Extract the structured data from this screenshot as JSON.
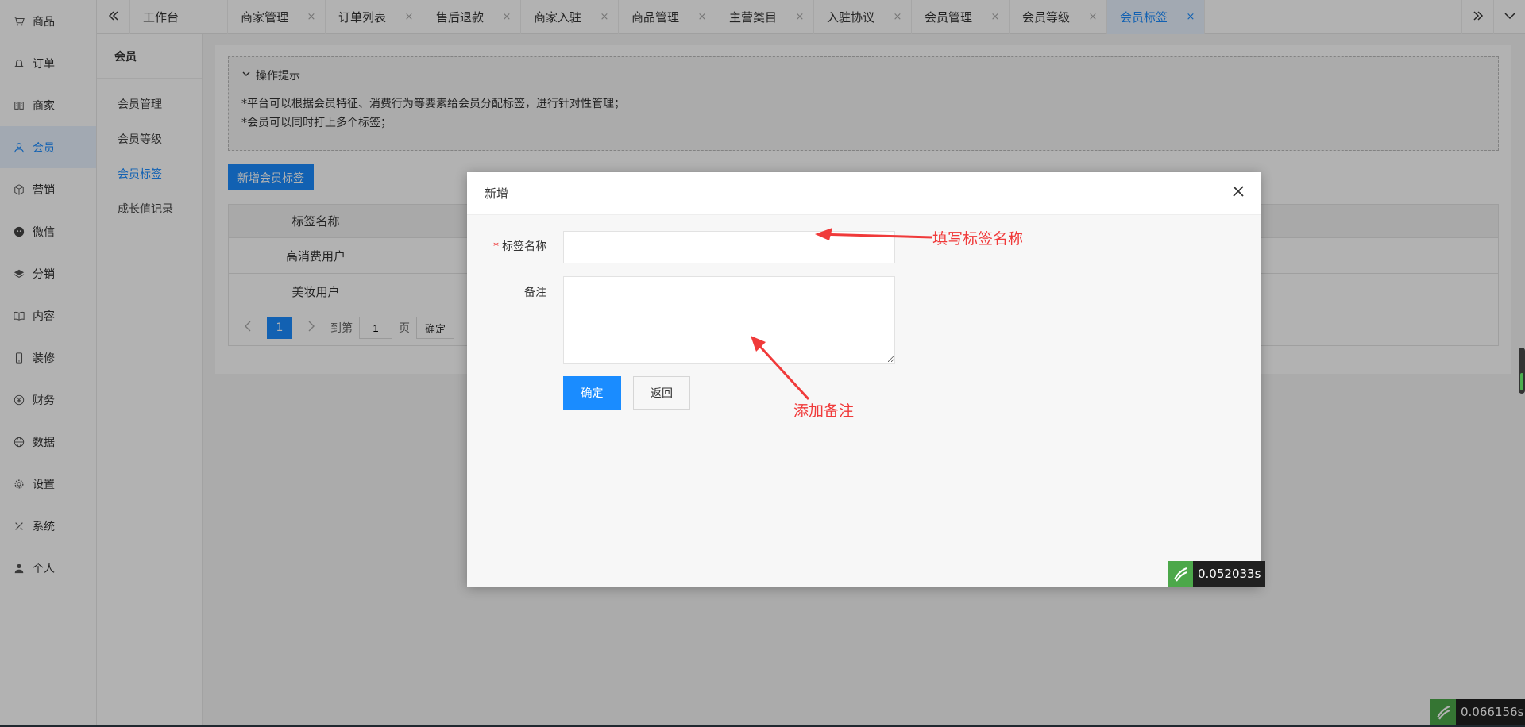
{
  "mainnav": {
    "items": [
      {
        "label": "商品",
        "icon": "cart-icon"
      },
      {
        "label": "订单",
        "icon": "bell-icon"
      },
      {
        "label": "商家",
        "icon": "store-icon"
      },
      {
        "label": "会员",
        "icon": "user-icon",
        "active": true
      },
      {
        "label": "营销",
        "icon": "box-icon"
      },
      {
        "label": "微信",
        "icon": "wechat-icon"
      },
      {
        "label": "分销",
        "icon": "layers-icon"
      },
      {
        "label": "内容",
        "icon": "book-icon"
      },
      {
        "label": "装修",
        "icon": "mobile-icon"
      },
      {
        "label": "财务",
        "icon": "yen-icon"
      },
      {
        "label": "数据",
        "icon": "globe-icon"
      },
      {
        "label": "设置",
        "icon": "gear-icon"
      },
      {
        "label": "系统",
        "icon": "tools-icon"
      },
      {
        "label": "个人",
        "icon": "person-icon"
      }
    ]
  },
  "subnav": {
    "title": "会员",
    "items": [
      {
        "label": "会员管理"
      },
      {
        "label": "会员等级"
      },
      {
        "label": "会员标签",
        "active": true
      },
      {
        "label": "成长值记录"
      }
    ]
  },
  "tabbar": {
    "tabs": [
      {
        "label": "工作台",
        "closable": false
      },
      {
        "label": "商家管理",
        "closable": true
      },
      {
        "label": "订单列表",
        "closable": true
      },
      {
        "label": "售后退款",
        "closable": true
      },
      {
        "label": "商家入驻",
        "closable": true
      },
      {
        "label": "商品管理",
        "closable": true
      },
      {
        "label": "主营类目",
        "closable": true
      },
      {
        "label": "入驻协议",
        "closable": true
      },
      {
        "label": "会员管理",
        "closable": true
      },
      {
        "label": "会员等级",
        "closable": true
      },
      {
        "label": "会员标签",
        "closable": true,
        "active": true
      }
    ],
    "close_glyph": "×"
  },
  "tips": {
    "title": "操作提示",
    "lines": [
      "*平台可以根据会员特征、消费行为等要素给会员分配标签，进行针对性管理；",
      "*会员可以同时打上多个标签；"
    ]
  },
  "add_button": "新增会员标签",
  "table": {
    "header": "标签名称",
    "rows": [
      "高消费用户",
      "美妆用户"
    ]
  },
  "pager": {
    "current": "1",
    "goto_label": "到第",
    "goto_value": "1",
    "page_unit": "页",
    "ok": "确定"
  },
  "modal": {
    "title": "新增",
    "field_name_label": "标签名称",
    "field_name_required": "*",
    "field_note_label": "备注",
    "confirm": "确定",
    "back": "返回",
    "annotation_name": "填写标签名称",
    "annotation_note": "添加备注"
  },
  "timers": {
    "modal_timer": "0.052033s",
    "page_timer": "0.066156s"
  },
  "colors": {
    "accent": "#1a8cff",
    "annotation": "#f03a3a"
  }
}
